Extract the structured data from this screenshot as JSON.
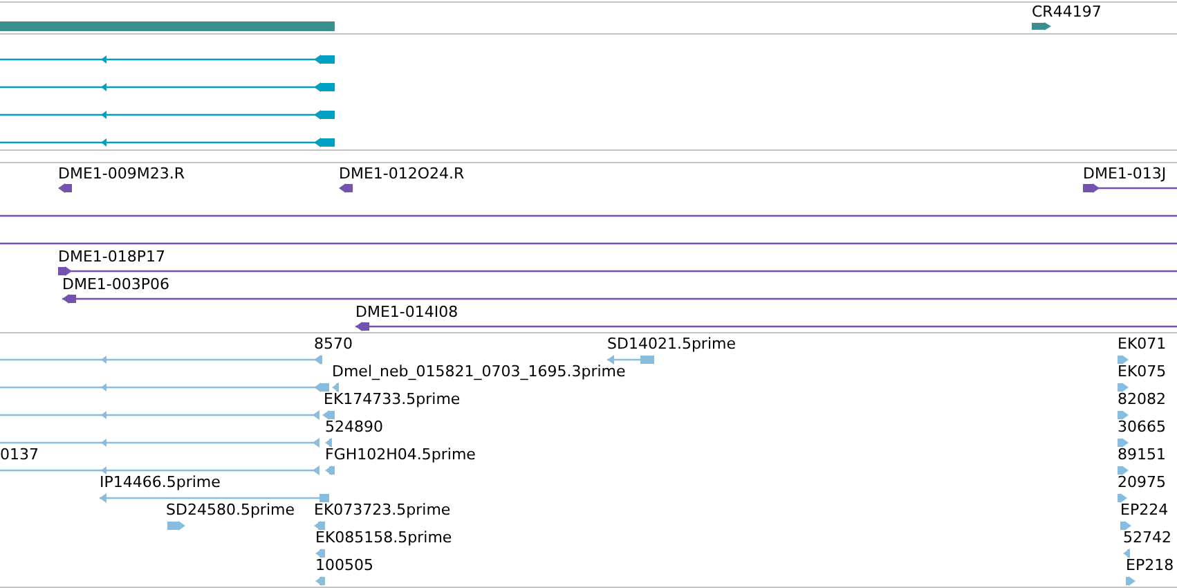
{
  "tracks": [
    {
      "color": "#3d8f8f",
      "features": [
        {
          "kind": "plain"
        },
        {
          "label": "CR44197",
          "kind": "forward"
        }
      ]
    },
    {
      "color": "#00a0c4",
      "features": [
        {
          "kind": "reverse"
        },
        {
          "kind": "reverse"
        },
        {
          "kind": "reverse"
        },
        {
          "kind": "reverse"
        }
      ]
    },
    {
      "color": "#7452b0",
      "features": [
        {
          "label": "DME1-009M23.R",
          "kind": "reverse"
        },
        {
          "label": "DME1-012O24.R",
          "kind": "reverse"
        },
        {
          "label": "DME1-013J",
          "kind": "forward"
        },
        {
          "kind": "plain"
        },
        {
          "kind": "plain"
        },
        {
          "label": "DME1-018P17",
          "kind": "forward"
        },
        {
          "label": "DME1-003P06",
          "kind": "reverse"
        },
        {
          "label": "DME1-014I08",
          "kind": "reverse"
        }
      ]
    },
    {
      "color": "#88bde0",
      "features": [
        {
          "label": "8570",
          "kind": "reverse"
        },
        {
          "label": "SD14021.5prime",
          "kind": "reverse"
        },
        {
          "label": "EK071",
          "kind": "forward"
        },
        {
          "kind": "reverse"
        },
        {
          "label": "Dmel_neb_015821_0703_1695.3prime",
          "kind": "reverse"
        },
        {
          "label": "EK075",
          "kind": "forward"
        },
        {
          "kind": "reverse"
        },
        {
          "label": "EK174733.5prime",
          "kind": "reverse"
        },
        {
          "label": "82082",
          "kind": "forward"
        },
        {
          "kind": "reverse"
        },
        {
          "label": "524890",
          "kind": "reverse"
        },
        {
          "label": "30665",
          "kind": "forward"
        },
        {
          "label": "0137",
          "kind": "reverse"
        },
        {
          "label": "FGH102H04.5prime",
          "kind": "reverse"
        },
        {
          "label": "89151",
          "kind": "forward"
        },
        {
          "label": "IP14466.5prime",
          "kind": "reverse"
        },
        {
          "label": "20975",
          "kind": "forward"
        },
        {
          "label": "SD24580.5prime",
          "kind": "forward"
        },
        {
          "label": "EK073723.5prime",
          "kind": "reverse"
        },
        {
          "label": "EP224",
          "kind": "forward"
        },
        {
          "label": "EK085158.5prime",
          "kind": "reverse"
        },
        {
          "label": "52742",
          "kind": "reverse"
        },
        {
          "label": "100505",
          "kind": "reverse"
        },
        {
          "label": "EP218",
          "kind": "forward"
        }
      ]
    }
  ]
}
